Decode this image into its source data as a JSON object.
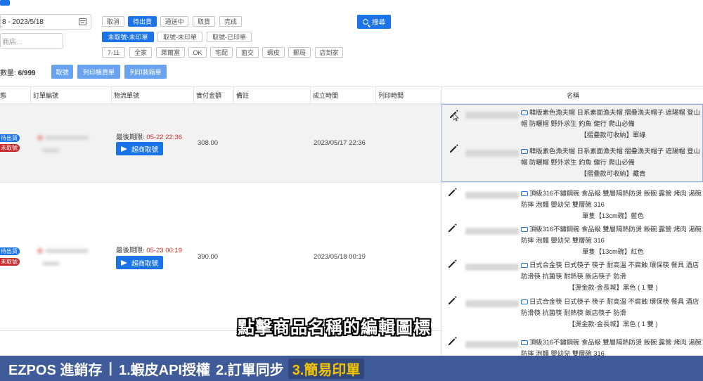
{
  "filters": {
    "date_range": "8 - 2023/5/18",
    "store_placeholder": "商店...",
    "status_chips": [
      "取消",
      "待出貨",
      "通送中",
      "取貨",
      "完成"
    ],
    "active_status": "待出貨",
    "ship_no_chips": [
      "未取號-未印單",
      "取號-未印單",
      "取號-已印單"
    ],
    "carrier_chips": [
      "7-11",
      "全家",
      "萊爾富",
      "OK",
      "宅配",
      "面交",
      "蝦皮",
      "郵局",
      "店到家"
    ],
    "search_label": "搜尋"
  },
  "toolbar": {
    "count_label": "數量:",
    "count_value": "6/999",
    "take_number": "取號",
    "print_shipping": "列印橫貨單",
    "print_packing": "列印裝箱單"
  },
  "table": {
    "headers": [
      "態",
      "訂單編號",
      "物流單號",
      "實付金額",
      "備註",
      "成立時間",
      "列印時間",
      "名稱"
    ],
    "rows": [
      {
        "status_1": "待出貨",
        "status_2": "未取號",
        "deadline_label": "最後期限:",
        "deadline_date": "05-22 22:36",
        "claim_label": "超商取號",
        "amount": "308.00",
        "created": "2023/05/17 22:36",
        "items": [
          {
            "title_1": "韓版素色漁夫帽 日系素面漁夫帽 摺疊漁夫帽子 遮陽帽 登山",
            "title_2": "帽 防曬帽 野外求生 釣魚 健行 爬山必備",
            "spec": "【摺疊款可收納】軍綠"
          },
          {
            "title_1": "韓版素色漁夫帽 日系素面漁夫帽 摺疊漁夫帽子 遮陽帽 登山",
            "title_2": "帽 防曬帽 野外求生 釣魚 健行 爬山必備",
            "spec": "【摺疊款可收納】藏青"
          }
        ]
      },
      {
        "status_1": "待出貨",
        "status_2": "未取號",
        "deadline_label": "最後期限:",
        "deadline_date": "05-23 00:19",
        "claim_label": "超商取號",
        "amount": "390.00",
        "created": "2023/05/18 00:19",
        "items": [
          {
            "title_1": "頂級316不鏽鋼碗 食品級 雙層隔熱防燙 飯碗 露營 烤肉 湯碗",
            "title_2": "防摔 泡麵 嬰幼兒 雙層碗 316",
            "spec": "單隻【13cm碗】藍色"
          },
          {
            "title_1": "頂級316不鏽鋼碗 食品級 雙層隔熱防燙 飯碗 露營 烤肉 湯碗",
            "title_2": "防摔 泡麵 嬰幼兒 雙層碗 316",
            "spec": "單隻【13cm碗】紅色"
          },
          {
            "title_1": "日式合金筷 日式筷子 筷子 耐高溫 不腐蝕 環保筷 餐具 酒店",
            "title_2": "防滑筷 抗菌筷 耐熱筷 飯店筷子 防滑",
            "spec": "【燙金款-金長城】黑色 ( 1 雙 )"
          },
          {
            "title_1": "日式合金筷 日式筷子 筷子 耐高溫 不腐蝕 環保筷 餐具 酒店",
            "title_2": "防滑筷 抗菌筷 耐熱筷 飯店筷子 防滑",
            "spec": "【燙金款-金長城】黑色 ( 1 雙 )"
          },
          {
            "title_1": "頂級316不鏽鋼碗 食品級 雙層隔熱防燙 飯碗 露營 烤肉 湯碗",
            "title_2": "防摔 泡麵 嬰幼兒 雙層碗 316",
            "spec": ""
          }
        ]
      }
    ]
  },
  "subtitle": "點擊商品名稱的編輯圖標",
  "banner": {
    "brand": "EZPOS 進銷存",
    "step1": "1.蝦皮API授權",
    "step2": "2.訂單同步",
    "step3": "3.簡易印單"
  },
  "colors": {
    "accent": "#1a73e8",
    "danger": "#c62828",
    "banner_bg": "#3f5b99",
    "banner_highlight": "#f5c400"
  }
}
